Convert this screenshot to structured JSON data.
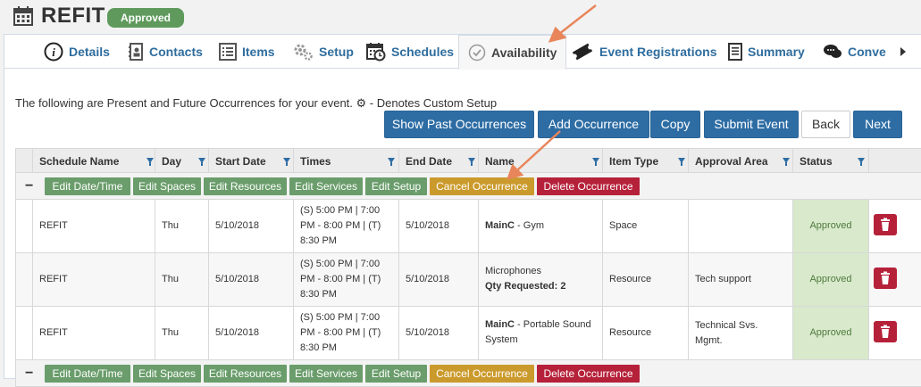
{
  "header": {
    "title": "REFIT",
    "status": "Approved"
  },
  "tabs": [
    {
      "label": "Details",
      "icon": "info-icon"
    },
    {
      "label": "Contacts",
      "icon": "contacts-icon"
    },
    {
      "label": "Items",
      "icon": "list-icon"
    },
    {
      "label": "Setup",
      "icon": "gears-icon"
    },
    {
      "label": "Schedules",
      "icon": "calendar-clock-icon"
    },
    {
      "label": "Availability",
      "icon": "check-circle-icon"
    },
    {
      "label": "Event Registrations",
      "icon": "ticket-icon"
    },
    {
      "label": "Summary",
      "icon": "document-icon"
    },
    {
      "label": "Conve",
      "icon": "chat-icon"
    }
  ],
  "info_text": "The following are Present and Future Occurrences for your event. ⚙ - Denotes Custom Setup",
  "toolbar": {
    "show_past": "Show Past Occurrences",
    "add": "Add Occurrence",
    "copy": "Copy",
    "submit": "Submit Event",
    "back": "Back",
    "next": "Next"
  },
  "columns": [
    "Schedule Name",
    "Day",
    "Start Date",
    "Times",
    "End Date",
    "Name",
    "Item Type",
    "Approval Area",
    "Status"
  ],
  "actions": {
    "collapse": "−",
    "edit_datetime": "Edit Date/Time",
    "edit_spaces": "Edit Spaces",
    "edit_resources": "Edit Resources",
    "edit_services": "Edit Services",
    "edit_setup": "Edit Setup",
    "cancel": "Cancel Occurrence",
    "delete": "Delete Occurrence"
  },
  "rows": [
    {
      "schedule": "REFIT",
      "day": "Thu",
      "start": "5/10/2018",
      "times": "(S) 5:00 PM | 7:00 PM - 8:00 PM | (T) 8:30 PM",
      "end": "5/10/2018",
      "name_bold": "MainC",
      "name_rest": " - Gym",
      "name_extra": "",
      "type": "Space",
      "area": "",
      "status": "Approved"
    },
    {
      "schedule": "REFIT",
      "day": "Thu",
      "start": "5/10/2018",
      "times": "(S) 5:00 PM | 7:00 PM - 8:00 PM | (T) 8:30 PM",
      "end": "5/10/2018",
      "name_bold": "",
      "name_rest": "Microphones",
      "name_extra": "Qty Requested: 2",
      "type": "Resource",
      "area": "Tech support",
      "status": "Approved"
    },
    {
      "schedule": "REFIT",
      "day": "Thu",
      "start": "5/10/2018",
      "times": "(S) 5:00 PM | 7:00 PM - 8:00 PM | (T) 8:30 PM",
      "end": "5/10/2018",
      "name_bold": "MainC",
      "name_rest": " - Portable Sound System",
      "name_extra": "",
      "type": "Resource",
      "area": "Technical Svs. Mgmt.",
      "status": "Approved"
    }
  ],
  "colors": {
    "primary": "#2e6da4",
    "green": "#6a9d6b",
    "orange": "#cb9a2c",
    "red": "#b6213a",
    "approved_bg": "#d8e9cc",
    "arrow": "#e8855a"
  }
}
